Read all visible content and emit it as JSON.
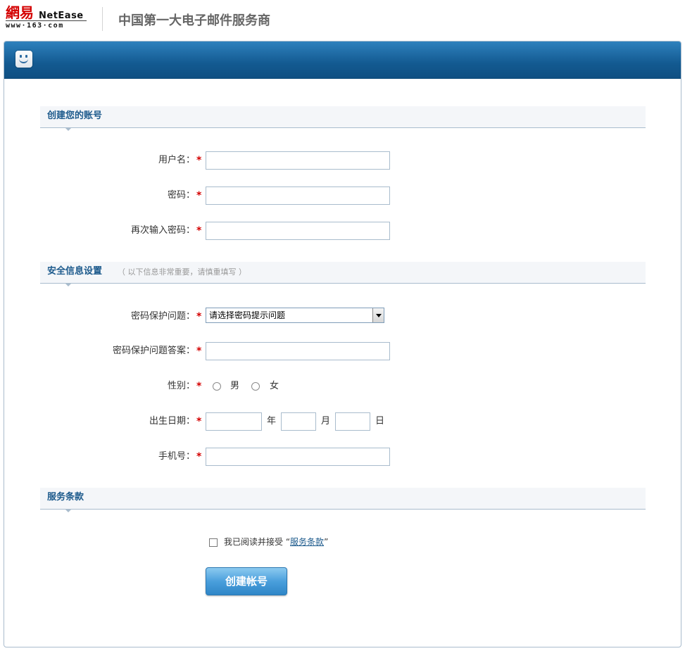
{
  "header": {
    "logo_cn": "網易",
    "logo_en": "NetEase",
    "logo_url": "www·163·com",
    "slogan": "中国第一大电子邮件服务商"
  },
  "section1": {
    "title": "创建您的账号",
    "fields": [
      {
        "label": "用户名：",
        "required": "*",
        "value": ""
      },
      {
        "label": "密码：",
        "required": "*",
        "value": ""
      },
      {
        "label": "再次输入密码：",
        "required": "*",
        "value": ""
      }
    ]
  },
  "section2": {
    "title": "安全信息设置",
    "note": "（ 以下信息非常重要，请慎重填写 ）",
    "question": {
      "label": "密码保护问题：",
      "required": "*",
      "selected": "请选择密码提示问题"
    },
    "answer": {
      "label": "密码保护问题答案：",
      "required": "*",
      "value": ""
    },
    "gender": {
      "label": "性别：",
      "required": "*",
      "options": [
        "男",
        "女"
      ]
    },
    "birthday": {
      "label": "出生日期：",
      "required": "*",
      "year_unit": "年",
      "month_unit": "月",
      "day_unit": "日"
    },
    "mobile": {
      "label": "手机号：",
      "required": "*",
      "value": ""
    }
  },
  "section3": {
    "title": "服务条款",
    "agree_text": "我已阅读并接受 “",
    "agree_link": "服务条款",
    "agree_close": "”"
  },
  "submit": {
    "label": "创建帐号"
  },
  "colors": {
    "header_blue": "#135a91",
    "section_title": "#1c5a8c",
    "required": "#d40000"
  },
  "icons": {
    "header_icon": "smile-icon"
  }
}
